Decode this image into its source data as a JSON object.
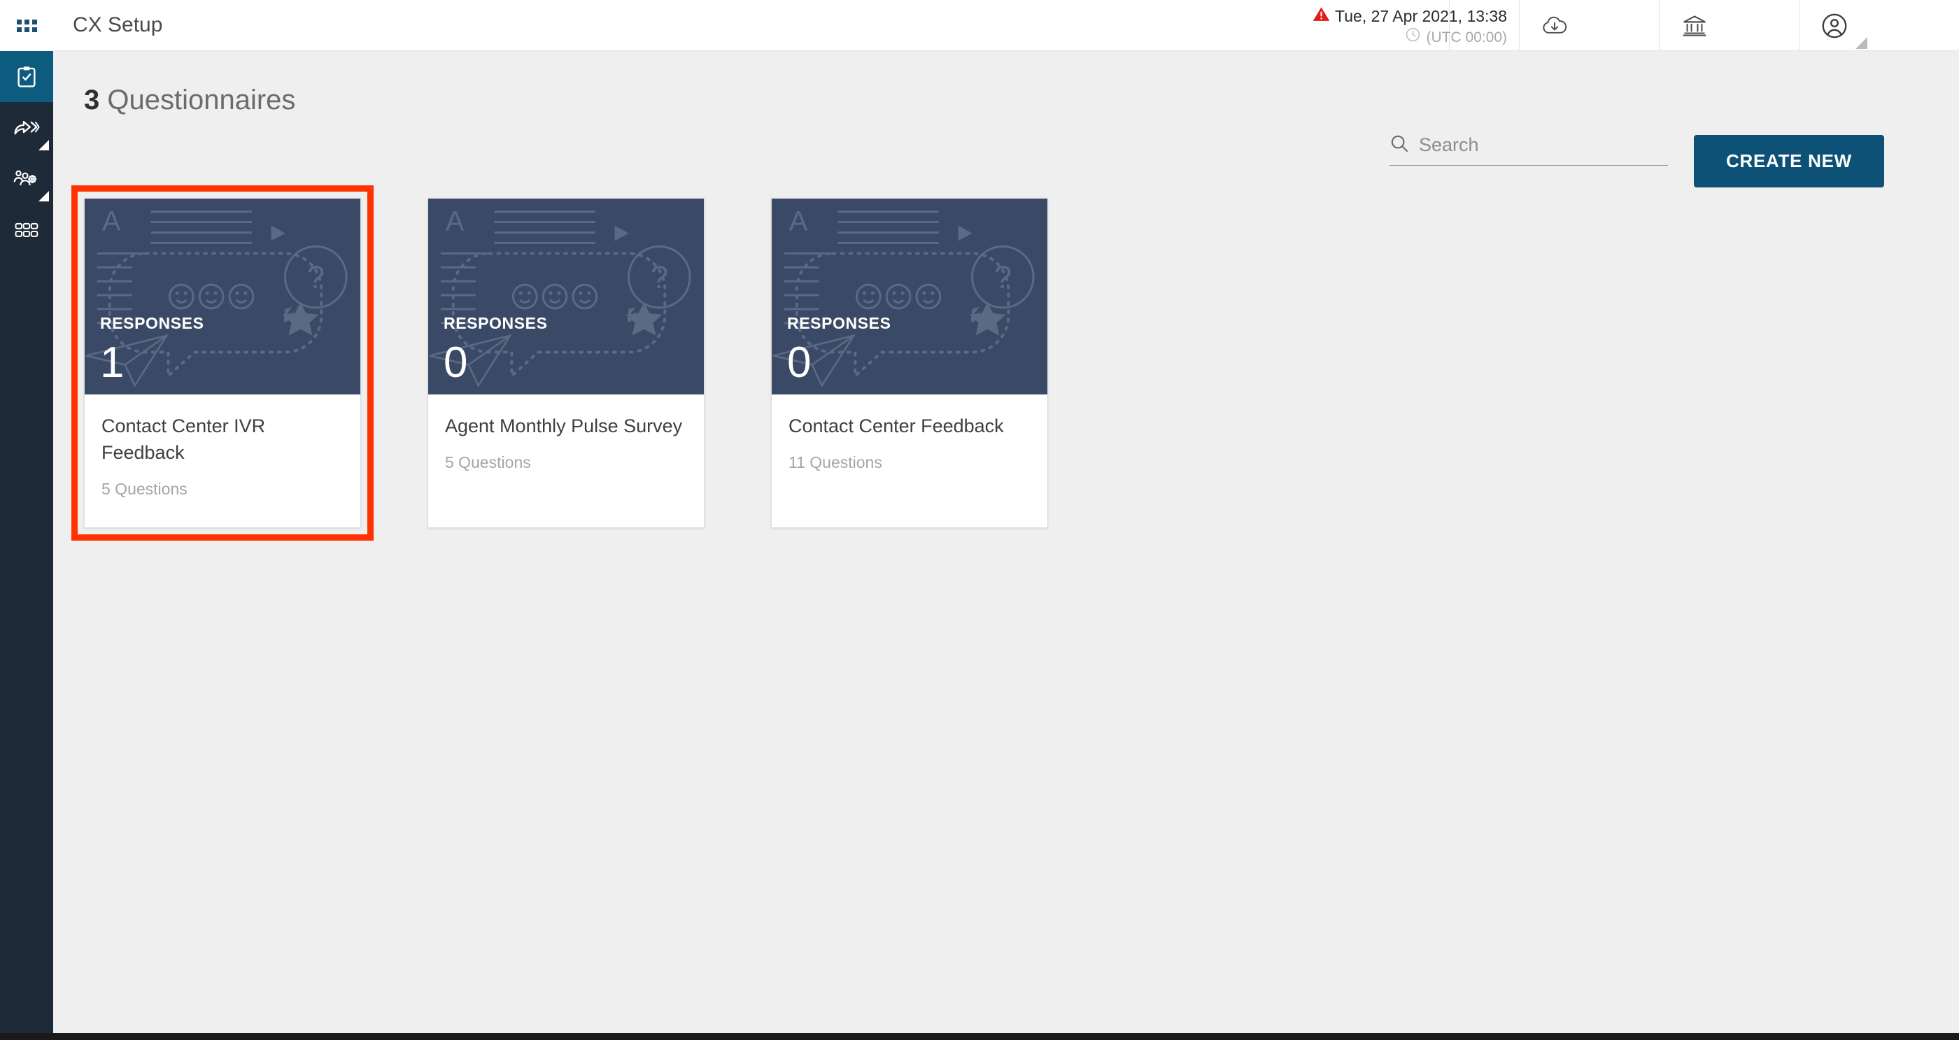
{
  "app": {
    "title": "CX Setup",
    "accent_color": "#0d5176",
    "sidebar_color": "#1e2a38",
    "highlight_color": "#ff3300",
    "card_thumb_color": "#3a4a66"
  },
  "sidebar": {
    "logo_icon": "app-grid-icon",
    "items": [
      {
        "icon": "clipboard-check-icon",
        "name": "questionnaires",
        "active": true,
        "has_submenu": false
      },
      {
        "icon": "share-arrow-icon",
        "name": "distribution",
        "active": false,
        "has_submenu": true
      },
      {
        "icon": "people-gear-icon",
        "name": "administration",
        "active": false,
        "has_submenu": true
      },
      {
        "icon": "grid-matrix-icon",
        "name": "modules",
        "active": false,
        "has_submenu": false
      }
    ]
  },
  "header": {
    "title": "CX Setup",
    "warning_icon": "warning-triangle-icon",
    "datetime": "Tue, 27 Apr 2021, 13:38",
    "clock_icon": "clock-icon",
    "timezone": "(UTC 00:00)",
    "icons": [
      {
        "icon": "cloud-download-icon",
        "name": "cloud-download-button"
      },
      {
        "icon": "bank-icon",
        "name": "organisation-button"
      },
      {
        "icon": "user-circle-icon",
        "name": "account-button"
      }
    ]
  },
  "main": {
    "count": "3",
    "heading_suffix": "Questionnaires",
    "search": {
      "icon": "search-icon",
      "placeholder": "Search",
      "value": ""
    },
    "create_button": "CREATE NEW",
    "cards": [
      {
        "responses_label": "RESPONSES",
        "responses_count": "1",
        "title": "Contact Center IVR Feedback",
        "questions": "5 Questions",
        "highlighted": true
      },
      {
        "responses_label": "RESPONSES",
        "responses_count": "0",
        "title": "Agent Monthly Pulse Survey",
        "questions": "5 Questions",
        "highlighted": false
      },
      {
        "responses_label": "RESPONSES",
        "responses_count": "0",
        "title": "Contact Center Feedback",
        "questions": "11 Questions",
        "highlighted": false
      }
    ]
  }
}
